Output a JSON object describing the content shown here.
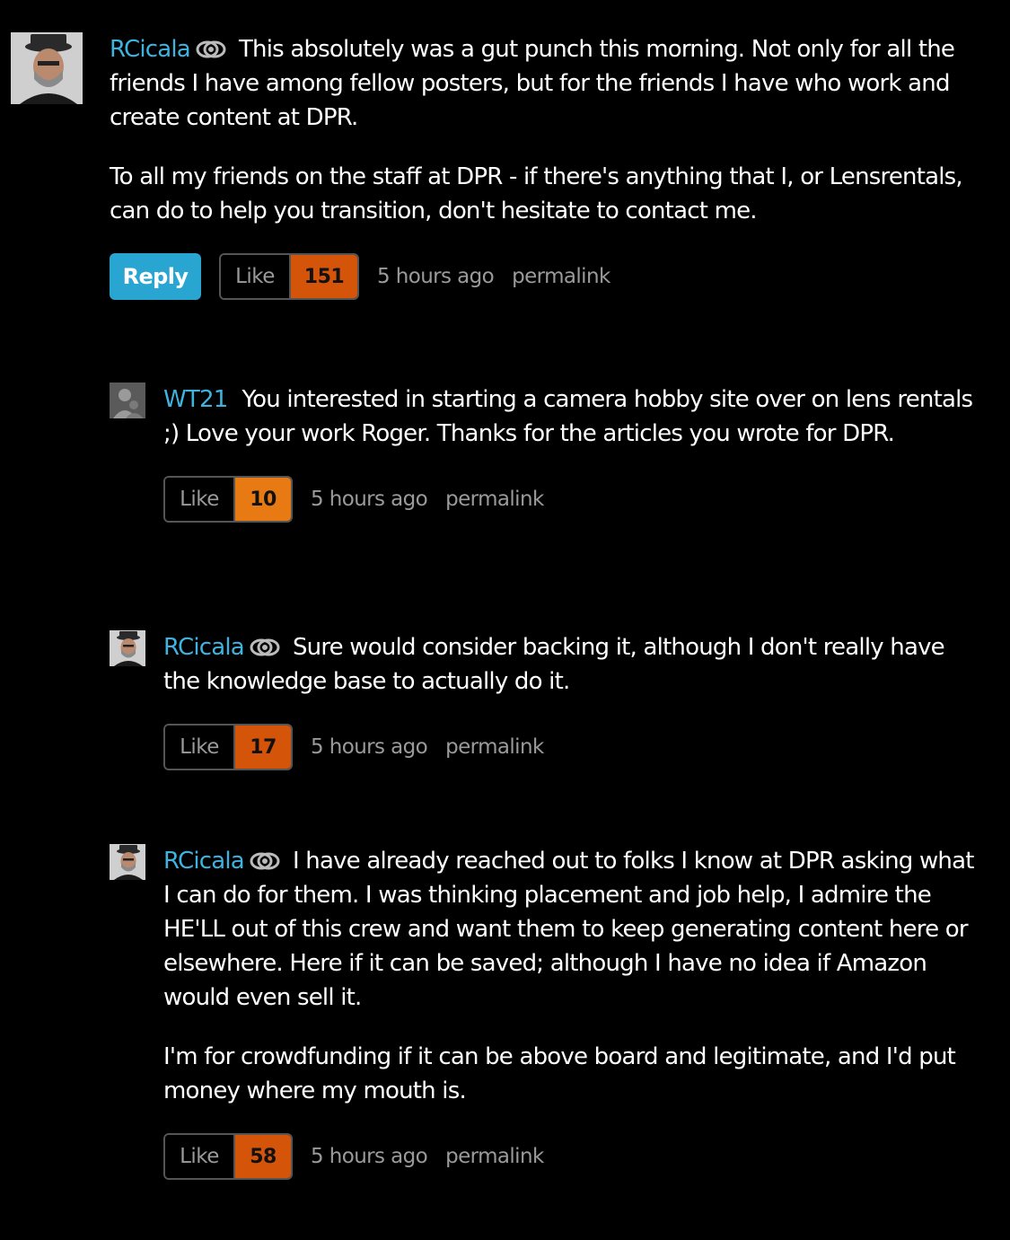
{
  "colors": {
    "background": "#000000",
    "username": "#3fb3e0",
    "reply_button": "#29a5d1",
    "like_count_dark_orange": "#d4540a",
    "like_count_orange": "#e77a12",
    "muted_text": "#9a9a9a"
  },
  "comments": [
    {
      "username": "RCicala",
      "badge_icon": "lensrentals-badge-icon",
      "paragraphs": [
        "This absolutely was a gut punch this morning. Not only for all the friends I have among fellow posters, but for the friends I have who work and create content at DPR.",
        "To all my friends on the staff at DPR - if there's anything that I, or Lensrentals, can do to help you transition, don't hesitate to contact me."
      ],
      "reply_label": "Reply",
      "like_label": "Like",
      "like_count": "151",
      "like_color": "#d4540a",
      "time": "5 hours ago",
      "permalink": "permalink"
    },
    {
      "username": "WT21",
      "paragraphs": [
        "You interested in starting a camera hobby site over on lens rentals ;) Love your work Roger. Thanks for the articles you wrote for DPR."
      ],
      "like_label": "Like",
      "like_count": "10",
      "like_color": "#e77a12",
      "time": "5 hours ago",
      "permalink": "permalink"
    },
    {
      "username": "RCicala",
      "badge_icon": "lensrentals-badge-icon",
      "paragraphs": [
        "Sure would consider backing it, although I don't really have the knowledge base to actually do it."
      ],
      "like_label": "Like",
      "like_count": "17",
      "like_color": "#d4540a",
      "time": "5 hours ago",
      "permalink": "permalink"
    },
    {
      "username": "RCicala",
      "badge_icon": "lensrentals-badge-icon",
      "paragraphs": [
        "I have already reached out to folks I know at DPR asking what I can do for them. I was thinking placement and job help, I admire the HE'LL out of this crew and want them to keep generating content here or elsewhere. Here if it can be saved; although I have no idea if Amazon would even sell it.",
        "I'm for crowdfunding if it can be above board and legitimate, and I'd put money where my mouth is."
      ],
      "like_label": "Like",
      "like_count": "58",
      "like_color": "#d4540a",
      "time": "5 hours ago",
      "permalink": "permalink"
    }
  ]
}
